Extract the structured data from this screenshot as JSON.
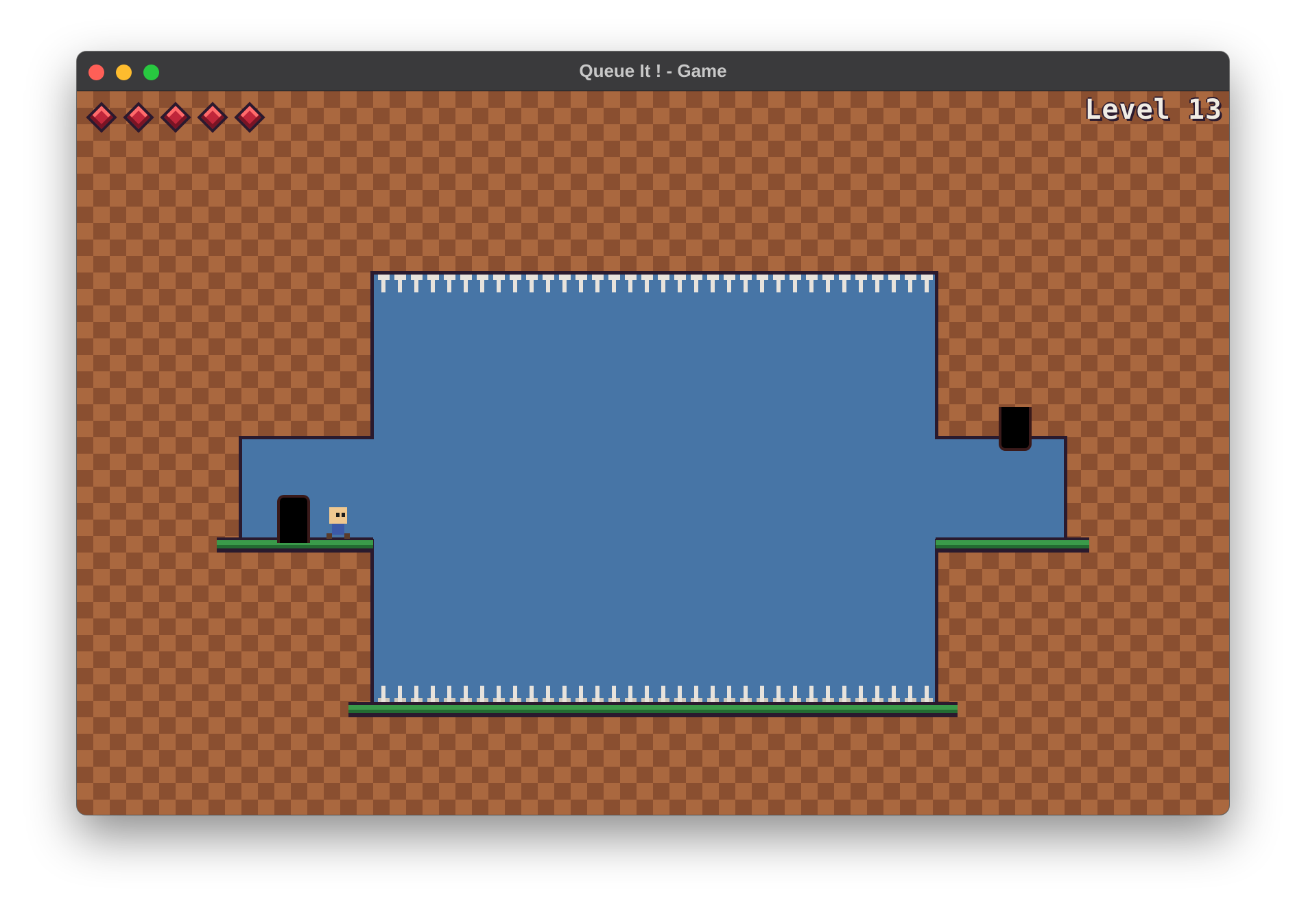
{
  "window": {
    "title": "Queue It ! - Game",
    "controls": {
      "close_color": "#ff5f57",
      "minimize_color": "#febc2e",
      "maximize_color": "#28c840"
    }
  },
  "hud": {
    "level_label": "Level 13",
    "lives": 5,
    "life_icon": "red-gem-icon"
  },
  "colors": {
    "dirt_light": "#aa683f",
    "dirt_dark": "#8a4f30",
    "sky": "#4775a6",
    "grass": "#3a9a4a",
    "outline": "#2a1a2e",
    "life_gem": "#c0263a"
  }
}
